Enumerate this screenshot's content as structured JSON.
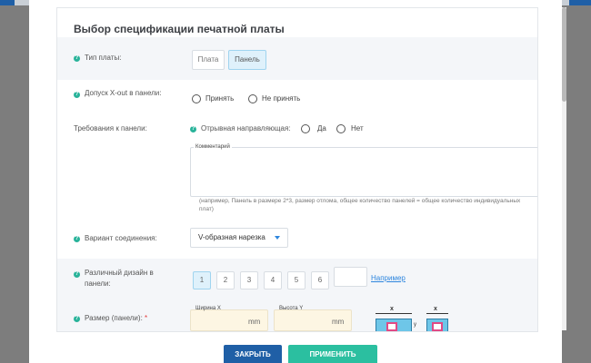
{
  "title": "Выбор спецификации печатной платы",
  "board_type": {
    "label": "Тип платы:",
    "options": [
      "Плата",
      "Панель"
    ],
    "selected": "Панель"
  },
  "xout": {
    "label": "Допуск X-out в панели:",
    "options": [
      "Принять",
      "Не принять"
    ]
  },
  "panel_req": {
    "label": "Требования к панели:",
    "guide_label": "Отрывная направляющая:",
    "options": [
      "Да",
      "Нет"
    ],
    "comment_legend": "Комментарий",
    "comment_value": "",
    "hint": "(например, Панель в размере 2*3, размер отлома, общее количество панелей = общее количество индивидуальных плат)"
  },
  "connection": {
    "label": "Вариант соединения:",
    "selected": "V-образная нарезка"
  },
  "designs": {
    "label": "Различный дизайн в панели:",
    "numbers": [
      "1",
      "2",
      "3",
      "4",
      "5",
      "6"
    ],
    "selected": "1",
    "link": "Например"
  },
  "size": {
    "label": "Размер (панели):",
    "required_mark": "*",
    "width_legend": "Ширина X",
    "height_legend": "Высота Y",
    "unit": "mm",
    "x_mark": "x",
    "y_mark": "y"
  },
  "footer": {
    "close": "ЗАКРЫТЬ",
    "apply": "ПРИМЕНИТЬ"
  },
  "colors": {
    "accent": "#2e86de",
    "help": "#29b39a",
    "close_btn": "#1f5fa6",
    "apply_btn": "#2bbfa0"
  }
}
